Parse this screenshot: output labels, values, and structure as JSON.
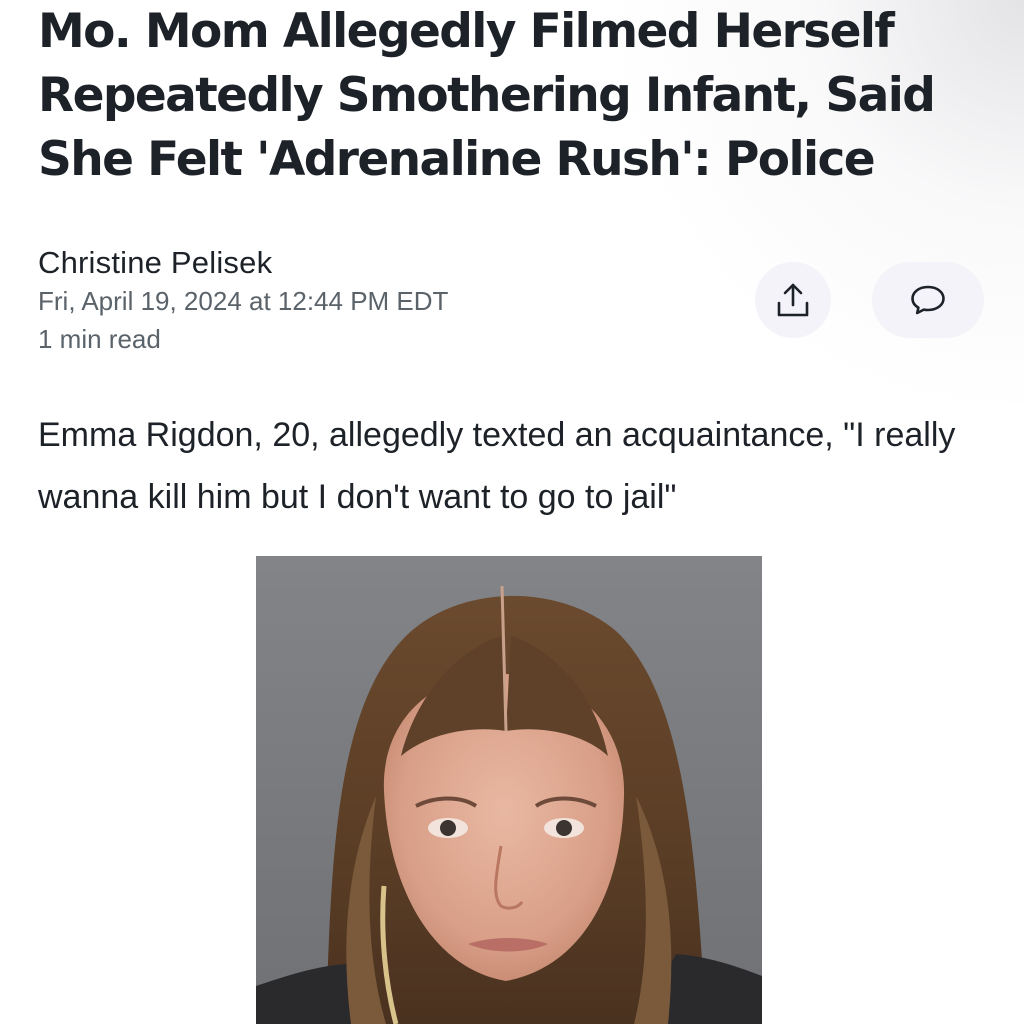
{
  "article": {
    "headline": "Mo. Mom Allegedly Filmed Herself Repeatedly Smothering Infant, Said She Felt 'Adrenaline Rush': Police",
    "author": "Christine Pelisek",
    "date": "Fri, April 19, 2024 at 12:44 PM EDT",
    "read_time": "1 min read",
    "summary": "Emma Rigdon, 20, allegedly texted an acquaintance, \"I really wanna kill him but I don't want to go to jail\""
  },
  "actions": {
    "share_icon": "share-icon",
    "comment_icon": "comment-icon"
  },
  "image": {
    "subject": "mugshot-photo"
  },
  "colors": {
    "text": "#1d2228",
    "meta_text": "#5b636a",
    "button_bg": "#f3f3f9",
    "icon": "#1d2228"
  }
}
